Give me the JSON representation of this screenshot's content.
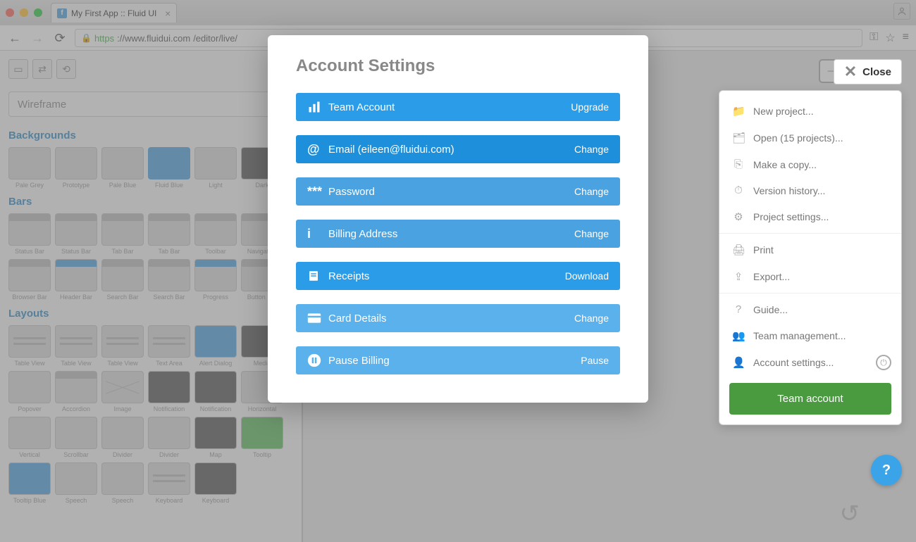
{
  "browser": {
    "tab_title": "My First App :: Fluid UI",
    "url_scheme": "https",
    "url_host": "://www.fluidui.com",
    "url_path": "/editor/live/"
  },
  "close_label": "Close",
  "library_select": "Wireframe",
  "categories": {
    "backgrounds": {
      "title": "Backgrounds",
      "items": [
        "Pale Grey",
        "Prototype",
        "Pale Blue",
        "Fluid Blue",
        "Light",
        "Dark"
      ]
    },
    "bars": {
      "title": "Bars",
      "row1": [
        "Status Bar",
        "Status Bar",
        "Tab Bar",
        "Tab Bar",
        "Toolbar",
        "Navigation"
      ],
      "row2": [
        "Browser Bar",
        "Header Bar",
        "Search Bar",
        "Search Bar",
        "Progress",
        "Button Bar"
      ]
    },
    "layouts": {
      "title": "Layouts",
      "row1": [
        "Table View",
        "Table View",
        "Table View",
        "Text Area",
        "Alert Dialog",
        "Media"
      ],
      "row2": [
        "Popover",
        "Accordion",
        "Image",
        "Notification",
        "Notification",
        "Horizontal"
      ],
      "row3": [
        "Vertical",
        "Scrollbar",
        "Divider",
        "Divider",
        "Map",
        "Tooltip"
      ],
      "row4": [
        "Tooltip Blue",
        "Speech",
        "Speech",
        "Keyboard",
        "Keyboard"
      ]
    }
  },
  "menu": {
    "new_project": "New project...",
    "open": "Open (15 projects)...",
    "copy": "Make a copy...",
    "history": "Version history...",
    "settings": "Project settings...",
    "print": "Print",
    "export": "Export...",
    "guide": "Guide...",
    "team_mgmt": "Team management...",
    "account": "Account settings...",
    "team_btn": "Team account"
  },
  "modal": {
    "title": "Account Settings",
    "rows": [
      {
        "label": "Team Account",
        "action": "Upgrade"
      },
      {
        "label": "Email (eileen@fluidui.com)",
        "action": "Change"
      },
      {
        "label": "Password",
        "action": "Change"
      },
      {
        "label": "Billing Address",
        "action": "Change"
      },
      {
        "label": "Receipts",
        "action": "Download"
      },
      {
        "label": "Card Details",
        "action": "Change"
      },
      {
        "label": "Pause Billing",
        "action": "Pause"
      }
    ]
  }
}
